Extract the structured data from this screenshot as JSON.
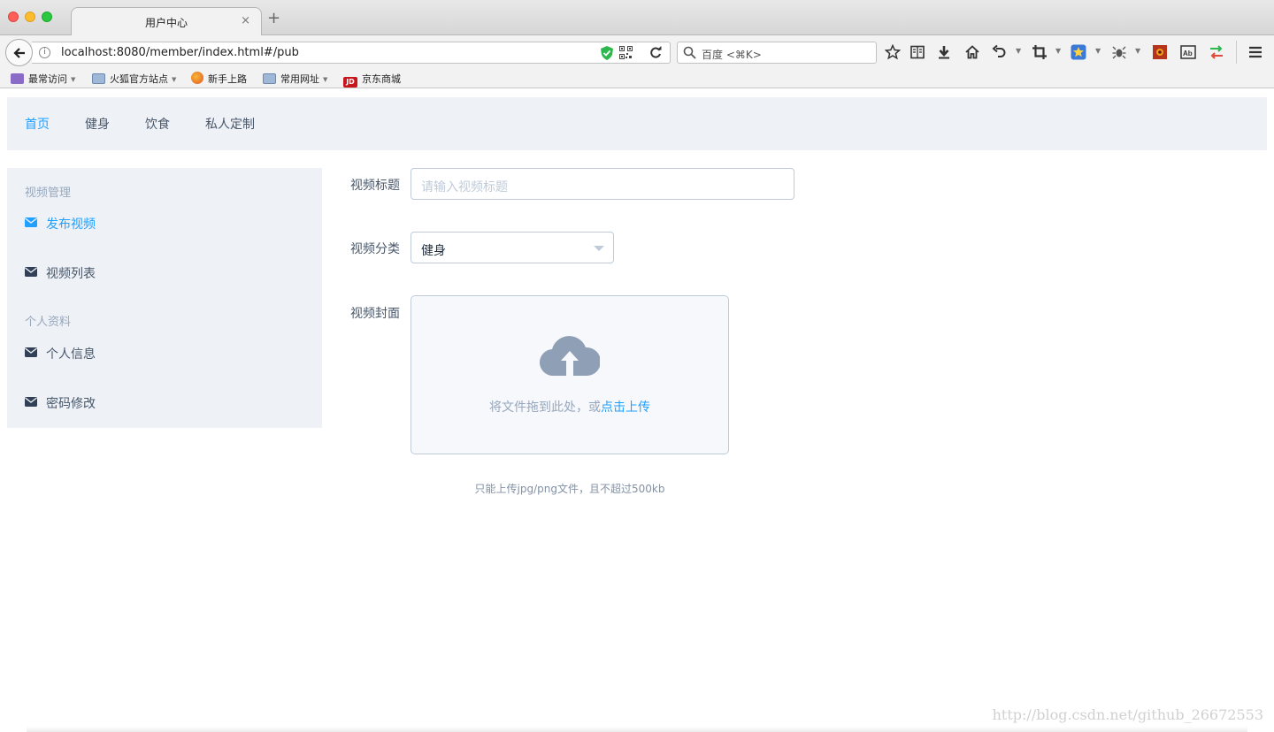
{
  "browser": {
    "tab_title": "用户中心",
    "tab_close": "×",
    "new_tab": "+",
    "url": "localhost:8080/member/index.html#/pub",
    "search_placeholder": "百度 <⌘K>",
    "bookmarks": [
      {
        "label": "最常访问",
        "dropdown": true
      },
      {
        "label": "火狐官方站点",
        "dropdown": true
      },
      {
        "label": "新手上路",
        "dropdown": false
      },
      {
        "label": "常用网址",
        "dropdown": true
      },
      {
        "label": "京东商城",
        "dropdown": false
      }
    ]
  },
  "topmenu": {
    "items": [
      "首页",
      "健身",
      "饮食",
      "私人定制"
    ],
    "active": "首页"
  },
  "sidebar": {
    "groups": [
      {
        "title": "视频管理",
        "items": [
          "发布视频",
          "视频列表"
        ]
      },
      {
        "title": "个人资料",
        "items": [
          "个人信息",
          "密码修改"
        ]
      }
    ],
    "active": "发布视频"
  },
  "form": {
    "title_label": "视频标题",
    "title_placeholder": "请输入视频标题",
    "category_label": "视频分类",
    "category_value": "健身",
    "cover_label": "视频封面",
    "upload_text": "将文件拖到此处，或",
    "upload_link": "点击上传",
    "upload_tip": "只能上传jpg/png文件，且不超过500kb"
  },
  "watermark": "http://blog.csdn.net/github_26672553",
  "colors": {
    "accent": "#20a0ff",
    "menu_bg": "#eef1f6",
    "border": "#bfcbd9",
    "text": "#48576a"
  }
}
